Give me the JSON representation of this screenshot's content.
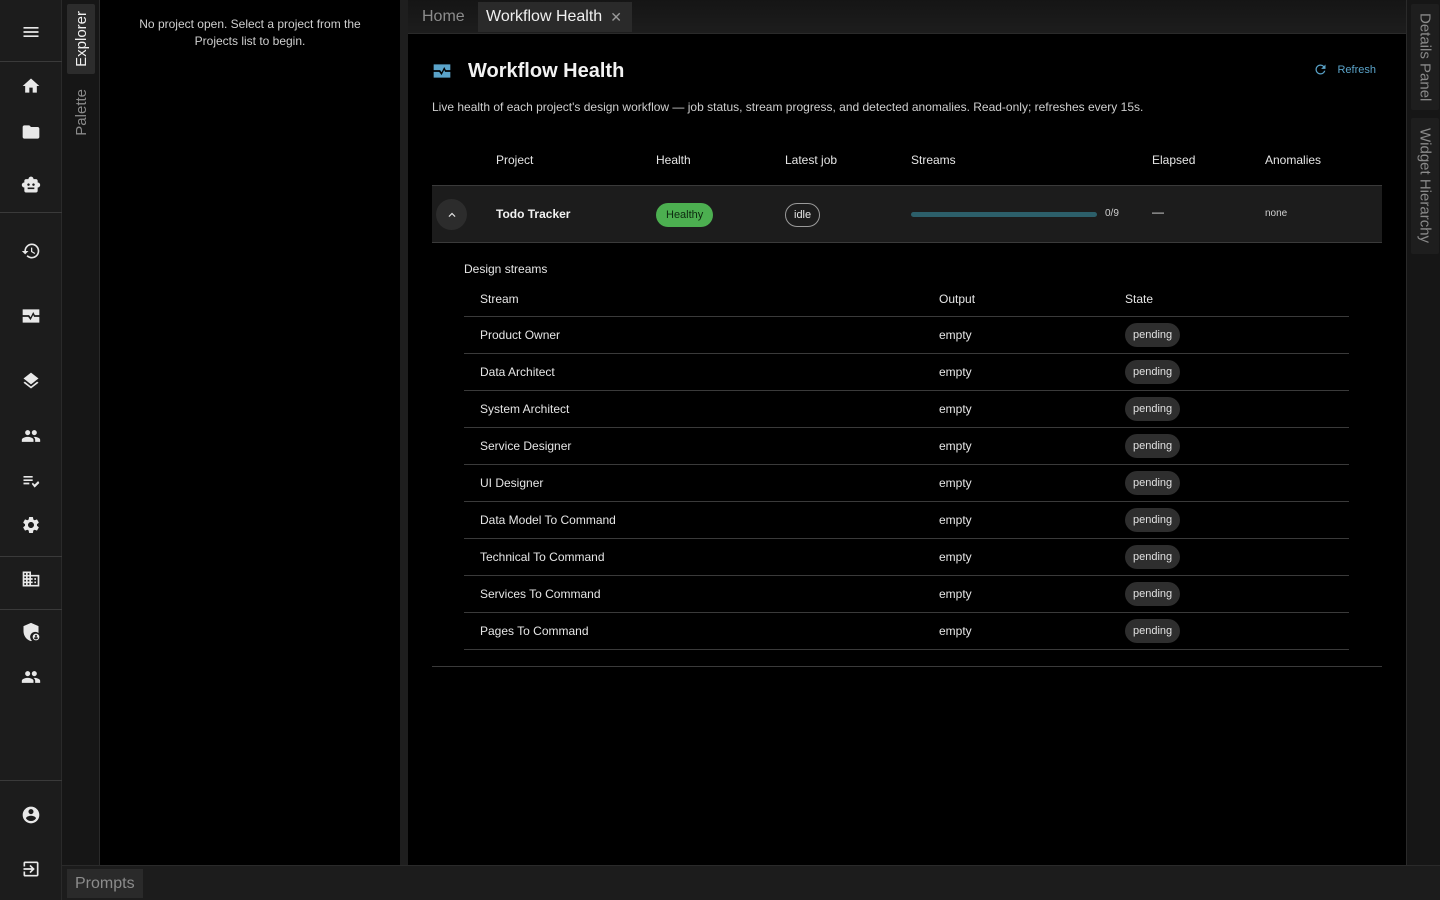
{
  "rail": {
    "items": [
      "menu-icon",
      "home-icon",
      "folder-icon",
      "robot-icon",
      "history-icon",
      "monitor-heart-icon",
      "layers-icon",
      "people-icon",
      "edit-list-icon",
      "settings-icon",
      "building-icon",
      "security-icon",
      "group-icon",
      "account-icon",
      "logout-icon"
    ]
  },
  "sidetabs": {
    "explorer": "Explorer",
    "palette": "Palette"
  },
  "explorer": {
    "empty": "No project open. Select a project from the Projects list to begin."
  },
  "tabs": {
    "home": "Home",
    "active": "Workflow Health",
    "close": "✕"
  },
  "page": {
    "title": "Workflow Health",
    "refresh": "Refresh",
    "description": "Live health of each project's design workflow — job status, stream progress, and detected anomalies. Read-only; refreshes every 15s."
  },
  "table": {
    "headers": {
      "project": "Project",
      "health": "Health",
      "latest_job": "Latest job",
      "streams": "Streams",
      "elapsed": "Elapsed",
      "anomalies": "Anomalies"
    },
    "project": {
      "name": "Todo Tracker",
      "health": "Healthy",
      "latest_job": "idle",
      "streams_done": 0,
      "streams_total": 9,
      "streams_label": "0/9",
      "elapsed": "—",
      "anomalies": "none"
    }
  },
  "streams": {
    "title": "Design streams",
    "headers": {
      "stream": "Stream",
      "output": "Output",
      "state": "State"
    },
    "rows": [
      {
        "name": "Product Owner",
        "output": "empty",
        "state": "pending"
      },
      {
        "name": "Data Architect",
        "output": "empty",
        "state": "pending"
      },
      {
        "name": "System Architect",
        "output": "empty",
        "state": "pending"
      },
      {
        "name": "Service Designer",
        "output": "empty",
        "state": "pending"
      },
      {
        "name": "UI Designer",
        "output": "empty",
        "state": "pending"
      },
      {
        "name": "Data Model To Command",
        "output": "empty",
        "state": "pending"
      },
      {
        "name": "Technical To Command",
        "output": "empty",
        "state": "pending"
      },
      {
        "name": "Services To Command",
        "output": "empty",
        "state": "pending"
      },
      {
        "name": "Pages To Command",
        "output": "empty",
        "state": "pending"
      }
    ]
  },
  "right": {
    "details": "Details Panel",
    "hierarchy": "Widget Hierarchy"
  },
  "bottom": {
    "prompts": "Prompts"
  },
  "colors": {
    "accent": "#5aa3c9",
    "healthy": "#4caf50",
    "progress": "#4fb3c9"
  }
}
